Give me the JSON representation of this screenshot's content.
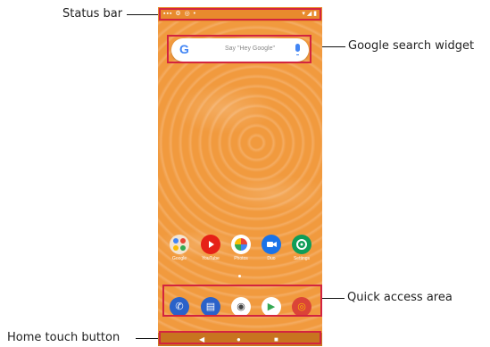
{
  "callouts": {
    "status_bar": "Status bar",
    "google_search_widget": "Google search widget",
    "quick_access_area": "Quick access area",
    "home_touch_button": "Home touch button"
  },
  "phone": {
    "status_left": "▪▪▪  ⚙  ◎  •",
    "status_right": "▾ ◢ ▮",
    "search_hint": "Say \"Hey Google\"",
    "google_letter": "G",
    "apps": [
      {
        "label": "Google",
        "icon": "google-folder-icon",
        "color": "#f4e4d0"
      },
      {
        "label": "YouTube",
        "icon": "youtube-icon",
        "color": "#e62117"
      },
      {
        "label": "Photos",
        "icon": "photos-icon",
        "color": "#ffffff"
      },
      {
        "label": "Duo",
        "icon": "duo-icon",
        "color": "#1a73e8"
      },
      {
        "label": "Settings",
        "icon": "settings-icon",
        "color": "#0f9d58"
      }
    ],
    "dock": [
      {
        "name": "phone-icon",
        "glyph": "✆",
        "color": "#2a62c9"
      },
      {
        "name": "messages-icon",
        "glyph": "▤",
        "color": "#2a62c9"
      },
      {
        "name": "camera-icon",
        "glyph": "◉",
        "color": "#ffffff"
      },
      {
        "name": "play-store-icon",
        "glyph": "▶",
        "color": "#ffffff"
      },
      {
        "name": "chrome-icon",
        "glyph": "◎",
        "color": "#db4437"
      }
    ],
    "nav": {
      "back": "◀",
      "home": "●",
      "recents": "■"
    }
  }
}
